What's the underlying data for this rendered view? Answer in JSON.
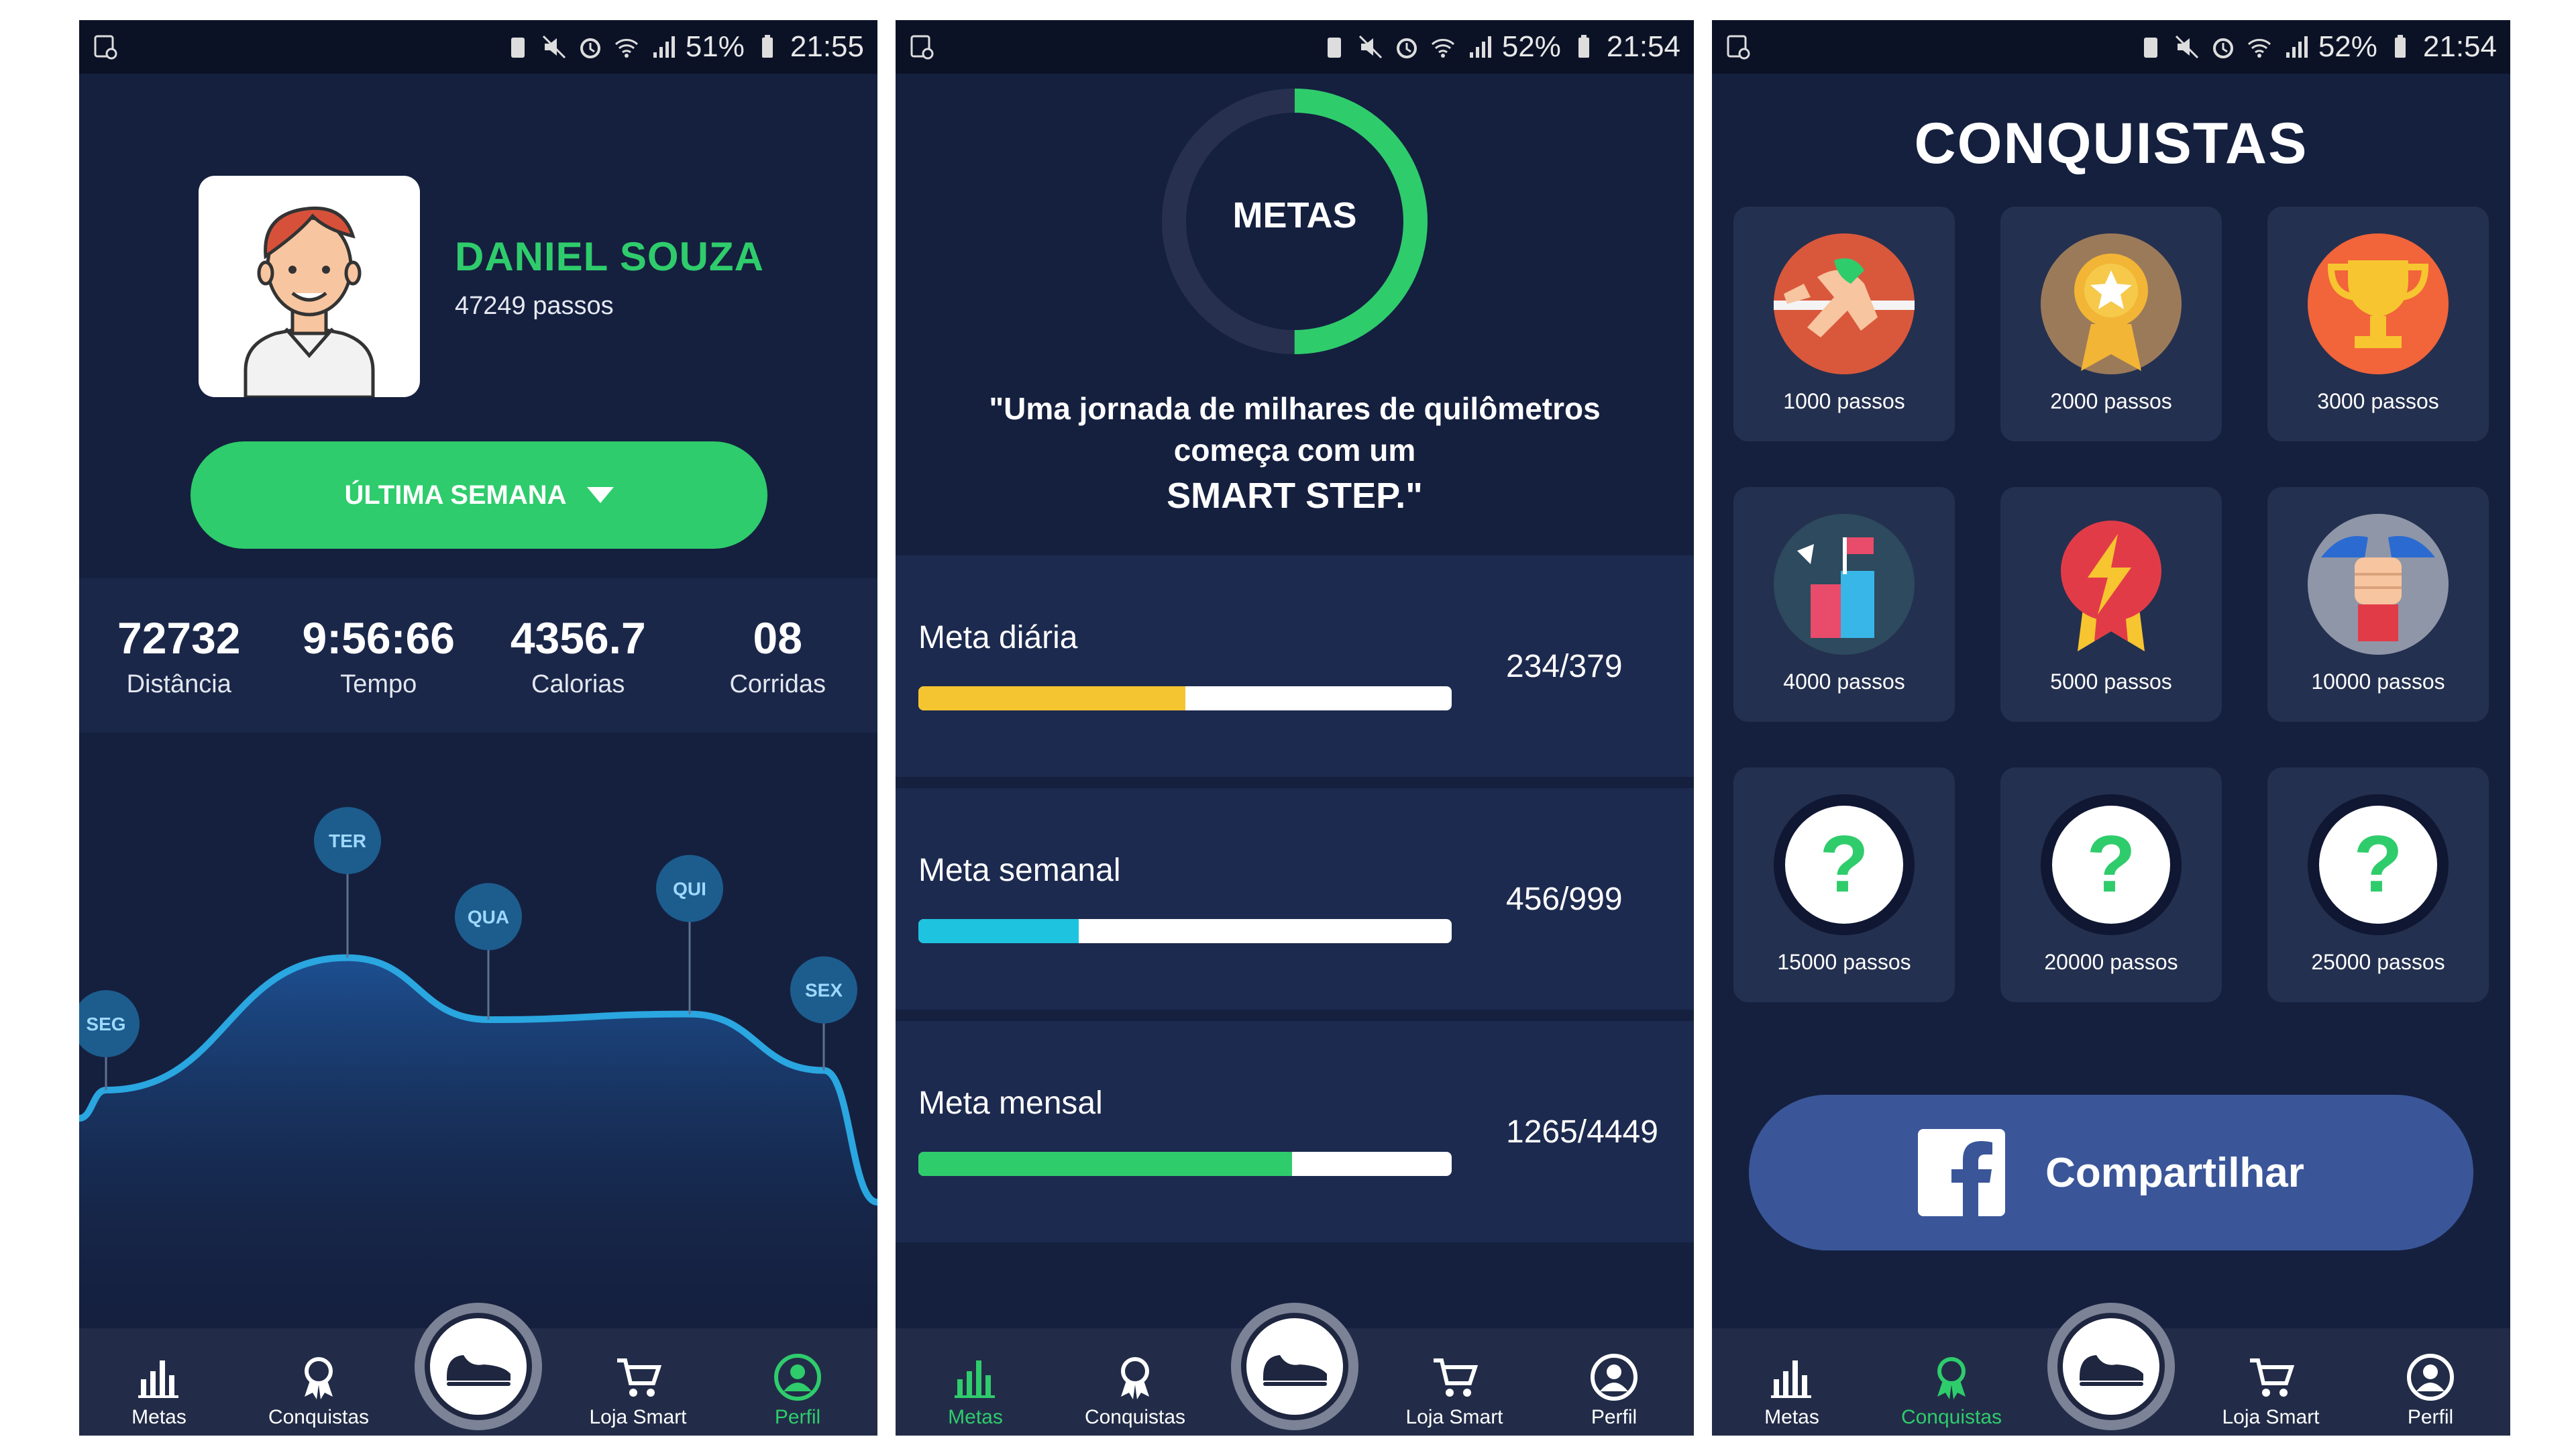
{
  "phones": [
    {
      "status": {
        "battery": "51%",
        "time": "21:55"
      },
      "profile": {
        "name": "DANIEL SOUZA",
        "steps": "47249 passos"
      },
      "period_button": "ÚLTIMA SEMANA",
      "stats": [
        {
          "value": "72732",
          "label": "Distância"
        },
        {
          "value": "9:56:66",
          "label": "Tempo"
        },
        {
          "value": "4356.7",
          "label": "Calorias"
        },
        {
          "value": "08",
          "label": "Corridas"
        }
      ],
      "chart_data": {
        "type": "area",
        "x": [
          "SEG",
          "TER",
          "QUA",
          "QUI",
          "SEX"
        ],
        "values": [
          0.35,
          0.82,
          0.6,
          0.62,
          0.42
        ],
        "colors": {
          "line": "#2aa6e0",
          "pin": "#1c5d8e"
        }
      }
    },
    {
      "status": {
        "battery": "52%",
        "time": "21:54"
      },
      "ring": {
        "title": "METAS",
        "progress": 0.5,
        "color": "#2fcc6c",
        "track": "#27314f"
      },
      "quote": {
        "line1": "\"Uma jornada de milhares de quilômetros",
        "line2": "começa com um",
        "emphasis": "SMART STEP.\""
      },
      "goals": [
        {
          "label": "Meta diária",
          "value": "234/379",
          "progress": 0.5,
          "color": "#f4c530"
        },
        {
          "label": "Meta semanal",
          "value": "456/999",
          "progress": 0.3,
          "color": "#1ec3e0"
        },
        {
          "label": "Meta mensal",
          "value": "1265/4449",
          "progress": 0.7,
          "color": "#2fcc6c"
        }
      ]
    },
    {
      "status": {
        "battery": "52%",
        "time": "21:54"
      },
      "title": "CONQUISTAS",
      "achievements": [
        {
          "label": "1000 passos",
          "icon": "runner-icon"
        },
        {
          "label": "2000 passos",
          "icon": "medal-star-icon"
        },
        {
          "label": "3000 passos",
          "icon": "trophy-icon"
        },
        {
          "label": "4000 passos",
          "icon": "podium-flag-icon"
        },
        {
          "label": "5000 passos",
          "icon": "lightning-medal-icon"
        },
        {
          "label": "10000 passos",
          "icon": "fist-icon"
        },
        {
          "label": "15000 passos",
          "icon": "locked-question-icon"
        },
        {
          "label": "20000 passos",
          "icon": "locked-question-icon"
        },
        {
          "label": "25000 passos",
          "icon": "locked-question-icon"
        }
      ],
      "share_button": "Compartilhar"
    }
  ],
  "nav": [
    "Metas",
    "Conquistas",
    "Loja Smart",
    "Perfil"
  ],
  "nav_active": [
    "Perfil",
    "Metas",
    "Conquistas"
  ],
  "colors": {
    "bg": "#15203f",
    "accent": "#2fcc6c",
    "nav_bg": "#222c48",
    "facebook": "#3a5699"
  }
}
